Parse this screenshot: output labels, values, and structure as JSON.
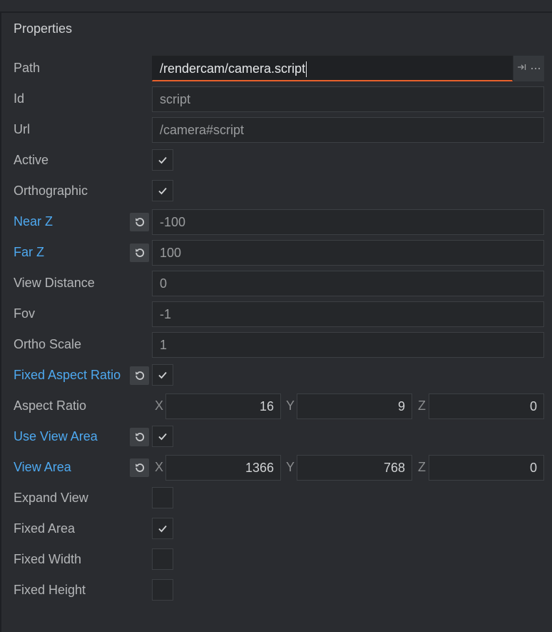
{
  "panel": {
    "title": "Properties"
  },
  "rows": {
    "path": {
      "label": "Path",
      "value": "/rendercam/camera.script"
    },
    "id": {
      "label": "Id",
      "value": "script"
    },
    "url": {
      "label": "Url",
      "value": "/camera#script"
    },
    "active": {
      "label": "Active",
      "checked": true
    },
    "orthographic": {
      "label": "Orthographic",
      "checked": true
    },
    "near_z": {
      "label": "Near Z",
      "value": "-100",
      "modified": true
    },
    "far_z": {
      "label": "Far Z",
      "value": "100",
      "modified": true
    },
    "view_distance": {
      "label": "View Distance",
      "value": "0"
    },
    "fov": {
      "label": "Fov",
      "value": "-1"
    },
    "ortho_scale": {
      "label": "Ortho Scale",
      "value": "1"
    },
    "fixed_aspect_ratio": {
      "label": "Fixed Aspect Ratio",
      "checked": true,
      "modified": true
    },
    "aspect_ratio": {
      "label": "Aspect Ratio",
      "x_label": "X",
      "x": "16",
      "y_label": "Y",
      "y": "9",
      "z_label": "Z",
      "z": "0"
    },
    "use_view_area": {
      "label": "Use View Area",
      "checked": true,
      "modified": true
    },
    "view_area": {
      "label": "View Area",
      "x_label": "X",
      "x": "1366",
      "y_label": "Y",
      "y": "768",
      "z_label": "Z",
      "z": "0",
      "modified": true
    },
    "expand_view": {
      "label": "Expand View",
      "checked": false
    },
    "fixed_area": {
      "label": "Fixed Area",
      "checked": true
    },
    "fixed_width": {
      "label": "Fixed Width",
      "checked": false
    },
    "fixed_height": {
      "label": "Fixed Height",
      "checked": false
    }
  },
  "icons": {
    "path_jump": "jump-to-icon",
    "path_browse": "ellipsis-icon",
    "reset": "reset-icon",
    "check": "checkmark-icon"
  },
  "colors": {
    "modified_label": "#4ea9f0",
    "focus_underline": "#e8612c",
    "background": "#2a2c30"
  }
}
